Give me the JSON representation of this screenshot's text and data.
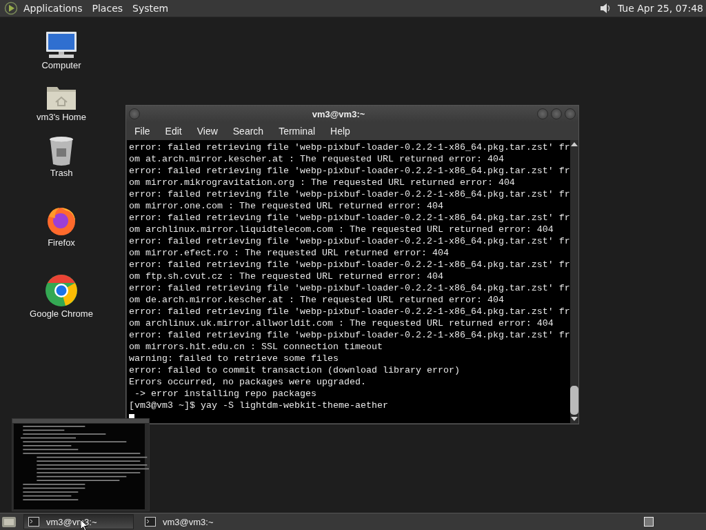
{
  "top_panel": {
    "menus": [
      "Applications",
      "Places",
      "System"
    ],
    "clock": "Tue Apr 25, 07:48"
  },
  "desktop_icons": [
    {
      "label": "Computer",
      "kind": "computer"
    },
    {
      "label": "vm3's Home",
      "kind": "home"
    },
    {
      "label": "Trash",
      "kind": "trash"
    },
    {
      "label": "Firefox",
      "kind": "firefox"
    },
    {
      "label": "Google Chrome",
      "kind": "chrome"
    }
  ],
  "terminal": {
    "title": "vm3@vm3:~",
    "menu": [
      "File",
      "Edit",
      "View",
      "Search",
      "Terminal",
      "Help"
    ],
    "lines": [
      "error: failed retrieving file 'webp-pixbuf-loader-0.2.2-1-x86_64.pkg.tar.zst' fr",
      "om at.arch.mirror.kescher.at : The requested URL returned error: 404",
      "error: failed retrieving file 'webp-pixbuf-loader-0.2.2-1-x86_64.pkg.tar.zst' fr",
      "om mirror.mikrogravitation.org : The requested URL returned error: 404",
      "error: failed retrieving file 'webp-pixbuf-loader-0.2.2-1-x86_64.pkg.tar.zst' fr",
      "om mirror.one.com : The requested URL returned error: 404",
      "error: failed retrieving file 'webp-pixbuf-loader-0.2.2-1-x86_64.pkg.tar.zst' fr",
      "om archlinux.mirror.liquidtelecom.com : The requested URL returned error: 404",
      "error: failed retrieving file 'webp-pixbuf-loader-0.2.2-1-x86_64.pkg.tar.zst' fr",
      "om mirror.efect.ro : The requested URL returned error: 404",
      "error: failed retrieving file 'webp-pixbuf-loader-0.2.2-1-x86_64.pkg.tar.zst' fr",
      "om ftp.sh.cvut.cz : The requested URL returned error: 404",
      "error: failed retrieving file 'webp-pixbuf-loader-0.2.2-1-x86_64.pkg.tar.zst' fr",
      "om de.arch.mirror.kescher.at : The requested URL returned error: 404",
      "error: failed retrieving file 'webp-pixbuf-loader-0.2.2-1-x86_64.pkg.tar.zst' fr",
      "om archlinux.uk.mirror.allworldit.com : The requested URL returned error: 404",
      "error: failed retrieving file 'webp-pixbuf-loader-0.2.2-1-x86_64.pkg.tar.zst' fr",
      "om mirrors.hit.edu.cn : SSL connection timeout",
      "warning: failed to retrieve some files",
      "error: failed to commit transaction (download library error)",
      "Errors occurred, no packages were upgraded.",
      " -> error installing repo packages",
      "[vm3@vm3 ~]$ yay -S lightdm-webkit-theme-aether"
    ]
  },
  "taskbar": {
    "tasks": [
      {
        "label": "vm3@vm3:~",
        "selected": true
      },
      {
        "label": "vm3@vm3:~",
        "selected": false
      }
    ]
  }
}
